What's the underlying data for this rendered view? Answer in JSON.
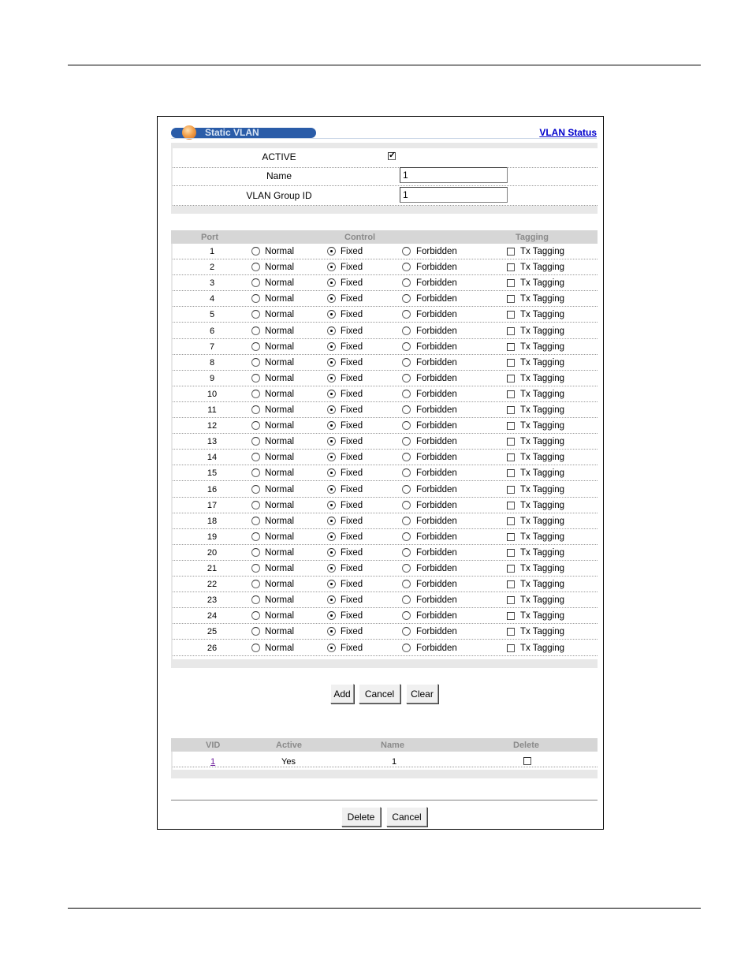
{
  "header": {
    "title": "Static VLAN",
    "status_link": "VLAN Status"
  },
  "form": {
    "active_label": "ACTIVE",
    "active_checked": true,
    "name_label": "Name",
    "name_value": "1",
    "group_id_label": "VLAN Group ID",
    "group_id_value": "1"
  },
  "port_table": {
    "columns": [
      "Port",
      "Control",
      "Tagging"
    ],
    "options": [
      "Normal",
      "Fixed",
      "Forbidden"
    ],
    "tagging_label": "Tx Tagging",
    "rows": [
      {
        "port": "1",
        "control": "Fixed",
        "tx_tagging": false
      },
      {
        "port": "2",
        "control": "Fixed",
        "tx_tagging": false
      },
      {
        "port": "3",
        "control": "Fixed",
        "tx_tagging": false
      },
      {
        "port": "4",
        "control": "Fixed",
        "tx_tagging": false
      },
      {
        "port": "5",
        "control": "Fixed",
        "tx_tagging": false
      },
      {
        "port": "6",
        "control": "Fixed",
        "tx_tagging": false
      },
      {
        "port": "7",
        "control": "Fixed",
        "tx_tagging": false
      },
      {
        "port": "8",
        "control": "Fixed",
        "tx_tagging": false
      },
      {
        "port": "9",
        "control": "Fixed",
        "tx_tagging": false
      },
      {
        "port": "10",
        "control": "Fixed",
        "tx_tagging": false
      },
      {
        "port": "11",
        "control": "Fixed",
        "tx_tagging": false
      },
      {
        "port": "12",
        "control": "Fixed",
        "tx_tagging": false
      },
      {
        "port": "13",
        "control": "Fixed",
        "tx_tagging": false
      },
      {
        "port": "14",
        "control": "Fixed",
        "tx_tagging": false
      },
      {
        "port": "15",
        "control": "Fixed",
        "tx_tagging": false
      },
      {
        "port": "16",
        "control": "Fixed",
        "tx_tagging": false
      },
      {
        "port": "17",
        "control": "Fixed",
        "tx_tagging": false
      },
      {
        "port": "18",
        "control": "Fixed",
        "tx_tagging": false
      },
      {
        "port": "19",
        "control": "Fixed",
        "tx_tagging": false
      },
      {
        "port": "20",
        "control": "Fixed",
        "tx_tagging": false
      },
      {
        "port": "21",
        "control": "Fixed",
        "tx_tagging": false
      },
      {
        "port": "22",
        "control": "Fixed",
        "tx_tagging": false
      },
      {
        "port": "23",
        "control": "Fixed",
        "tx_tagging": false
      },
      {
        "port": "24",
        "control": "Fixed",
        "tx_tagging": false
      },
      {
        "port": "25",
        "control": "Fixed",
        "tx_tagging": false
      },
      {
        "port": "26",
        "control": "Fixed",
        "tx_tagging": false
      }
    ]
  },
  "buttons": {
    "add": "Add",
    "cancel": "Cancel",
    "clear": "Clear",
    "delete": "Delete",
    "cancel2": "Cancel"
  },
  "summary_table": {
    "columns": [
      "VID",
      "Active",
      "Name",
      "Delete"
    ],
    "rows": [
      {
        "vid": "1",
        "active": "Yes",
        "name": "1",
        "delete": false
      }
    ]
  },
  "colors": {
    "title_pill": "#2a5ca8",
    "link": "#0000cc",
    "header_bar": "#d6d6d6"
  }
}
